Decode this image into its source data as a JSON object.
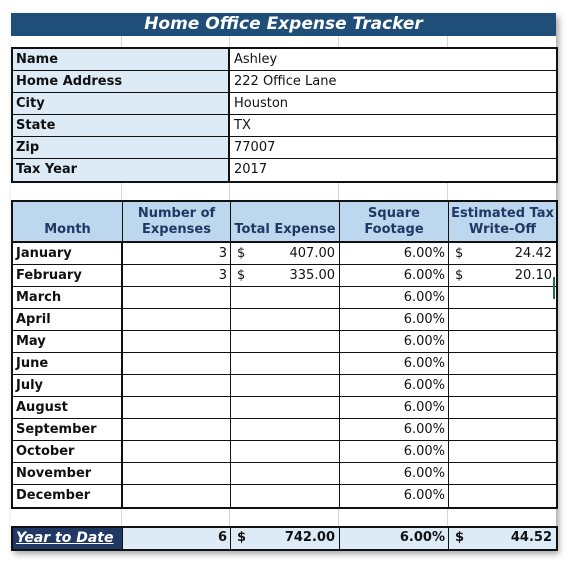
{
  "title": "Home Office Expense Tracker",
  "info": [
    {
      "label": "Name",
      "value": "Ashley"
    },
    {
      "label": "Home Address",
      "value": "222 Office Lane"
    },
    {
      "label": "City",
      "value": "Houston"
    },
    {
      "label": "State",
      "value": "TX"
    },
    {
      "label": "Zip",
      "value": "77007"
    },
    {
      "label": "Tax Year",
      "value": "2017"
    }
  ],
  "headers": [
    "Month",
    "Number of Expenses",
    "Total Expense",
    "Square Footage",
    "Estimated Tax Write-Off"
  ],
  "currency_symbol": "$",
  "rows": [
    {
      "month": "January",
      "count": "3",
      "total": "407.00",
      "sqft": "6.00%",
      "writeoff": "24.42"
    },
    {
      "month": "February",
      "count": "3",
      "total": "335.00",
      "sqft": "6.00%",
      "writeoff": "20.10"
    },
    {
      "month": "March",
      "count": "",
      "total": "",
      "sqft": "6.00%",
      "writeoff": ""
    },
    {
      "month": "April",
      "count": "",
      "total": "",
      "sqft": "6.00%",
      "writeoff": ""
    },
    {
      "month": "May",
      "count": "",
      "total": "",
      "sqft": "6.00%",
      "writeoff": ""
    },
    {
      "month": "June",
      "count": "",
      "total": "",
      "sqft": "6.00%",
      "writeoff": ""
    },
    {
      "month": "July",
      "count": "",
      "total": "",
      "sqft": "6.00%",
      "writeoff": ""
    },
    {
      "month": "August",
      "count": "",
      "total": "",
      "sqft": "6.00%",
      "writeoff": ""
    },
    {
      "month": "September",
      "count": "",
      "total": "",
      "sqft": "6.00%",
      "writeoff": ""
    },
    {
      "month": "October",
      "count": "",
      "total": "",
      "sqft": "6.00%",
      "writeoff": ""
    },
    {
      "month": "November",
      "count": "",
      "total": "",
      "sqft": "6.00%",
      "writeoff": ""
    },
    {
      "month": "December",
      "count": "",
      "total": "",
      "sqft": "6.00%",
      "writeoff": ""
    }
  ],
  "ytd": {
    "label": "Year to Date",
    "count": "6",
    "total": "742.00",
    "sqft": "6.00%",
    "writeoff": "44.52"
  },
  "colors": {
    "title_bg": "#1f4e79",
    "header_bg": "#bdd7ee",
    "label_bg": "#ddebf7",
    "ytd_label_bg": "#1f3864",
    "selection": "#217346"
  }
}
